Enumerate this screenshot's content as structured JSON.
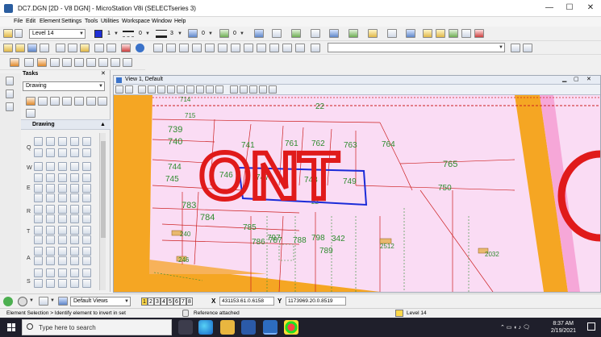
{
  "window": {
    "title": "DC7.DGN [2D - V8 DGN] - MicroStation V8i (SELECTseries 3)",
    "minimize": "—",
    "maximize": "☐",
    "close": "✕"
  },
  "menu": [
    "File",
    "Edit",
    "Element",
    "Settings",
    "Tools",
    "Utilities",
    "Workspace",
    "Window",
    "Help"
  ],
  "attributes": {
    "level": "Level 14",
    "color": "1",
    "style": "0",
    "weight": "3",
    "transparency": "0",
    "priority": "0",
    "active_color_hex": "#1f2fd6"
  },
  "tasks": {
    "header": "Tasks",
    "selected": "Drawing",
    "section": "Drawing",
    "row_letters": [
      "Q",
      "W",
      "E",
      "R",
      "T",
      "A",
      "S"
    ]
  },
  "view": {
    "title": "View 1, Default"
  },
  "drawing": {
    "ont_text": "ONT",
    "parcels": [
      "714",
      "715",
      "22",
      "739",
      "740",
      "741",
      "761",
      "762",
      "763",
      "764",
      "765",
      "744",
      "745",
      "746",
      "747",
      "748",
      "749",
      "750",
      "783",
      "784",
      "785",
      "786",
      "787",
      "788",
      "797",
      "798",
      "342",
      "789",
      "22",
      "2512",
      "2032",
      "240",
      "246"
    ],
    "colors": {
      "ont_red": "#e01a1a",
      "road_orange": "#f5a623",
      "land_pink": "#fadcf4",
      "parcel_green": "#2e8b2e",
      "boundary_red": "#cc1f1f",
      "highlight_blue": "#1b2bd8"
    }
  },
  "status": {
    "views": [
      "1",
      "2",
      "3",
      "4",
      "5",
      "6",
      "7",
      "8"
    ],
    "active_view": "1",
    "view_group": "Default Views",
    "x_label": "X",
    "x_value": "431153.61.0.6158",
    "y_label": "Y",
    "y_value": "1173969.20.0.8519",
    "message": "Element Selection > Identify element to invert in set",
    "reference": "Reference attached",
    "level": "Level 14"
  },
  "taskbar": {
    "search_placeholder": "Type here to search",
    "time": "8:37 AM",
    "date": "2/19/2021"
  }
}
